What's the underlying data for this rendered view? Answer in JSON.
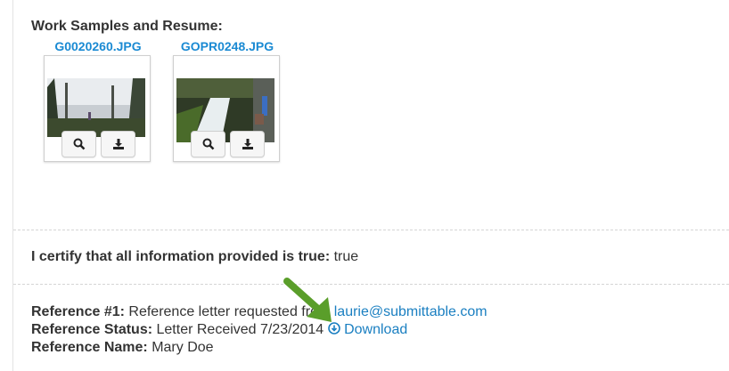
{
  "work_samples": {
    "title": "Work Samples and Resume:",
    "files": [
      {
        "name": "G0020260.JPG"
      },
      {
        "name": "GOPR0248.JPG"
      }
    ]
  },
  "certify": {
    "label": "I certify that all information provided is true:",
    "value": "true"
  },
  "reference": {
    "ref1_label": "Reference #1:",
    "ref1_text": "Reference letter requested from",
    "ref1_email": "laurie@submittable.com",
    "status_label": "Reference Status:",
    "status_text": "Letter Received 7/23/2014",
    "download_label": "Download",
    "name_label": "Reference Name:",
    "name_value": "Mary Doe"
  },
  "colors": {
    "link": "#1a7fc1",
    "arrow": "#5a9e2a"
  }
}
